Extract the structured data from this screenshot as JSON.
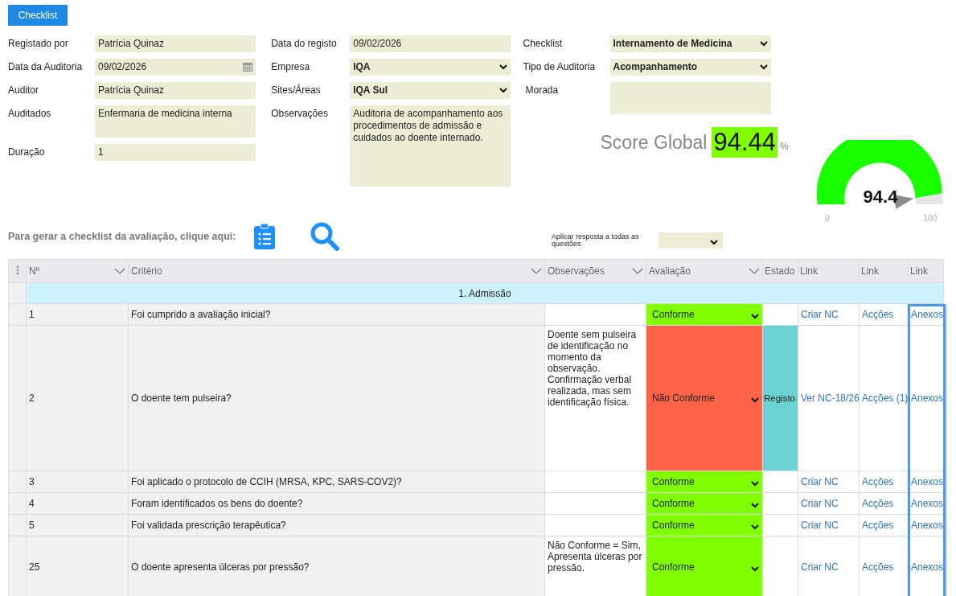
{
  "top_button": {
    "label": "Checklist"
  },
  "form_columns": [
    {
      "fields": [
        {
          "label": "Registado por",
          "value": "Patrícia Quinaz",
          "kind": "text"
        },
        {
          "label": "Data da Auditoria",
          "value": "09/02/2026",
          "kind": "date"
        },
        {
          "label": "Auditor",
          "value": "Patrícia Quinaz",
          "kind": "text"
        },
        {
          "label": "Auditados",
          "value": "Enfermaria de medicina interna",
          "kind": "textarea"
        },
        {
          "label": "Duração",
          "value": "1",
          "kind": "text"
        }
      ]
    },
    {
      "fields": [
        {
          "label": "Data do registo",
          "value": "09/02/2026",
          "kind": "text"
        },
        {
          "label": "Empresa",
          "value": "IQA",
          "kind": "select"
        },
        {
          "label": "Sites/Áreas",
          "value": "IQA Sul",
          "kind": "select"
        },
        {
          "label": "Observações",
          "value": "Auditoria de acompanhamento aos procedimentos de admissão e cuidados ao doente internado.",
          "kind": "textarea"
        }
      ]
    },
    {
      "fields": [
        {
          "label": "Checklist",
          "value": "Internamento de Medicina",
          "kind": "select"
        },
        {
          "label": "Tipo de Auditoria",
          "value": "Acompanhamento",
          "kind": "select"
        },
        {
          "label": "Morada",
          "kind": "textarea"
        }
      ]
    }
  ],
  "score": {
    "label": "Score Global",
    "value": "94.44",
    "unit": "%"
  },
  "gauge": {
    "level": 0.944,
    "value": "94.4",
    "min": "0",
    "max": "100"
  },
  "generate": {
    "text": "Para gerar a checklist da avaliação, clique aqui:"
  },
  "apply_all": {
    "label": "Aplicar resposta a todas as questões"
  },
  "table": {
    "columns": [
      {
        "label": "Nº",
        "sortable": true,
        "selected": false
      },
      {
        "label": "Critério",
        "sortable": true,
        "selected": false
      },
      {
        "label": "Observações",
        "sortable": true,
        "selected": false
      },
      {
        "label": "Avaliação",
        "sortable": true,
        "selected": false
      },
      {
        "label": "Estado",
        "sortable": false,
        "selected": false
      },
      {
        "label": "Link",
        "sortable": false,
        "selected": false
      },
      {
        "label": "Link",
        "sortable": false,
        "selected": false
      },
      {
        "label": "Link",
        "sortable": false,
        "selected": true
      }
    ],
    "rows": [
      {
        "kind": "section",
        "title": "1. Admissão"
      },
      {
        "kind": "question",
        "number": "1",
        "criterion": "Foi cumprido a avaliação inicial?",
        "evaluation": {
          "value": "Conforme",
          "color": "#80ff00"
        },
        "links": [
          "Criar NC",
          "Acções",
          "Anexos"
        ]
      },
      {
        "kind": "question",
        "number": "2",
        "criterion": "O doente tem pulseira?",
        "observations": "Doente sem pulseira de identificação no momento da observação. Confirmação verbal realizada, mas sem identificação física.",
        "evaluation": {
          "value": "Não Conforme",
          "color": "#ff6347"
        },
        "status": {
          "text": "Registo",
          "color": "#6cd1d1"
        },
        "links": [
          "Ver NC-18/26",
          "Acções (1)",
          "Anexos"
        ]
      },
      {
        "kind": "question",
        "number": "3",
        "criterion": "Foi aplicado o protocolo de CCIH (MRSA, KPC, SARS-COV2)?",
        "evaluation": {
          "value": "Conforme",
          "color": "#80ff00"
        },
        "links": [
          "Criar NC",
          "Acções",
          "Anexos"
        ]
      },
      {
        "kind": "question",
        "number": "4",
        "criterion": "Foram identificados os bens do doente?",
        "evaluation": {
          "value": "Conforme",
          "color": "#80ff00"
        },
        "links": [
          "Criar NC",
          "Acções",
          "Anexos"
        ]
      },
      {
        "kind": "question",
        "number": "5",
        "criterion": "Foi validada prescrição terapêutica?",
        "evaluation": {
          "value": "Conforme",
          "color": "#80ff00"
        },
        "links": [
          "Criar NC",
          "Acções",
          "Anexos"
        ]
      },
      {
        "kind": "question",
        "number": "25",
        "criterion": "O doente apresenta úlceras por pressão?",
        "observations": "Não Conforme = Sim, Apresenta úlceras por pressão.",
        "evaluation": {
          "value": "Conforme",
          "color": "#80ff00"
        },
        "links": [
          "Criar NC",
          "Acções",
          "Anexos"
        ]
      }
    ]
  }
}
